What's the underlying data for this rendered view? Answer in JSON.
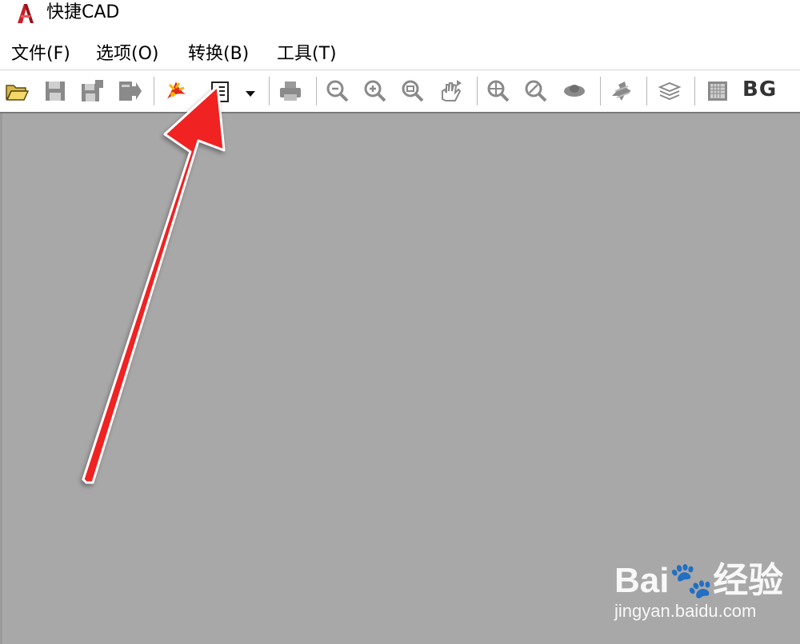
{
  "window": {
    "title": "快捷CAD",
    "app_icon": "autocad-red-a-icon"
  },
  "menu": [
    {
      "label": "文件(F)"
    },
    {
      "label": "选项(O)"
    },
    {
      "label": "转换(B)"
    },
    {
      "label": "工具(T)"
    }
  ],
  "toolbar": {
    "buttons": [
      {
        "icon": "open-folder-icon",
        "enabled": true
      },
      {
        "icon": "save-icon",
        "enabled": false
      },
      {
        "icon": "save-as-icon",
        "enabled": false
      },
      {
        "icon": "export-icon",
        "enabled": false
      },
      {
        "icon": "convert-pdf-icon",
        "enabled": true
      },
      {
        "icon": "document-list-icon",
        "enabled": true
      },
      {
        "icon": "print-icon",
        "enabled": false
      },
      {
        "icon": "zoom-out-icon",
        "enabled": false
      },
      {
        "icon": "zoom-in-icon",
        "enabled": false
      },
      {
        "icon": "zoom-window-icon",
        "enabled": false
      },
      {
        "icon": "pan-hand-icon",
        "enabled": false
      },
      {
        "icon": "zoom-extents-icon",
        "enabled": false
      },
      {
        "icon": "zoom-realtime-icon",
        "enabled": false
      },
      {
        "icon": "orbit-view-icon",
        "enabled": false
      },
      {
        "icon": "snap-settings-icon",
        "enabled": false
      },
      {
        "icon": "layers-icon",
        "enabled": false
      },
      {
        "icon": "grid-icon",
        "enabled": false
      }
    ],
    "bg_label": "BG"
  },
  "watermark": {
    "logo_text": "Bai🐾经验",
    "url": "jingyan.baidu.com"
  },
  "colors": {
    "canvas_bg": "#a8a8a8",
    "arrow": "#f02020",
    "app_icon_red": "#c8202a"
  }
}
